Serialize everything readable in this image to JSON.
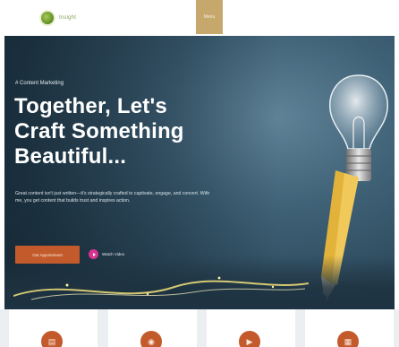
{
  "header": {
    "logo_text": "Insight",
    "menu_label": "Menu"
  },
  "hero": {
    "eyebrow": "# Content Marketing",
    "headline_lines": [
      "Together, Let's",
      "Craft Something",
      "Beautiful..."
    ],
    "description": "Great content isn't just written—it's strategically crafted to captivate, engage, and convert. With me, you get content that builds trust and inspires action.",
    "cta_label": "Get Appointment",
    "video_label": "Watch Video"
  },
  "cards": [
    {
      "icon": "document-icon"
    },
    {
      "icon": "megaphone-icon"
    },
    {
      "icon": "play-icon"
    },
    {
      "icon": "chart-icon"
    }
  ],
  "colors": {
    "accent": "#c35a2b",
    "menu_bg": "#c7a86c",
    "video_button": "#d9338f",
    "hero_bg": "#3e6075"
  }
}
